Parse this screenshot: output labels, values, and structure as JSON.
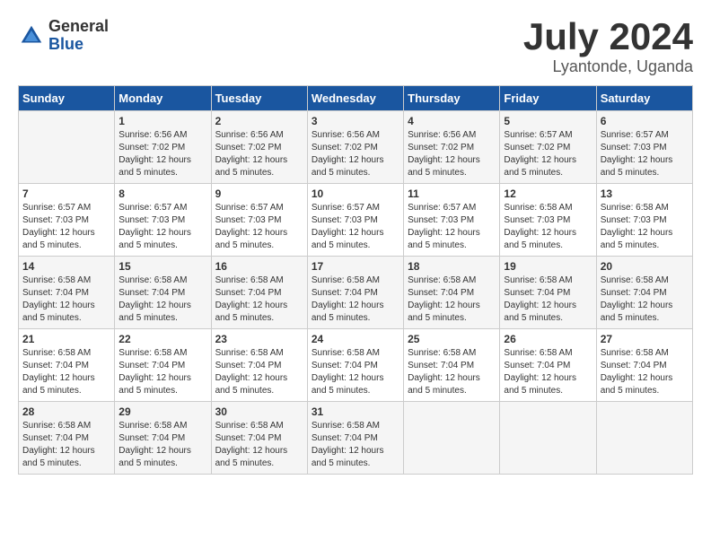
{
  "logo": {
    "general": "General",
    "blue": "Blue"
  },
  "title": {
    "month": "July 2024",
    "location": "Lyantonde, Uganda"
  },
  "calendar": {
    "headers": [
      "Sunday",
      "Monday",
      "Tuesday",
      "Wednesday",
      "Thursday",
      "Friday",
      "Saturday"
    ],
    "weeks": [
      [
        {
          "num": "",
          "info": ""
        },
        {
          "num": "1",
          "info": "Sunrise: 6:56 AM\nSunset: 7:02 PM\nDaylight: 12 hours\nand 5 minutes."
        },
        {
          "num": "2",
          "info": "Sunrise: 6:56 AM\nSunset: 7:02 PM\nDaylight: 12 hours\nand 5 minutes."
        },
        {
          "num": "3",
          "info": "Sunrise: 6:56 AM\nSunset: 7:02 PM\nDaylight: 12 hours\nand 5 minutes."
        },
        {
          "num": "4",
          "info": "Sunrise: 6:56 AM\nSunset: 7:02 PM\nDaylight: 12 hours\nand 5 minutes."
        },
        {
          "num": "5",
          "info": "Sunrise: 6:57 AM\nSunset: 7:02 PM\nDaylight: 12 hours\nand 5 minutes."
        },
        {
          "num": "6",
          "info": "Sunrise: 6:57 AM\nSunset: 7:03 PM\nDaylight: 12 hours\nand 5 minutes."
        }
      ],
      [
        {
          "num": "7",
          "info": "Sunrise: 6:57 AM\nSunset: 7:03 PM\nDaylight: 12 hours\nand 5 minutes."
        },
        {
          "num": "8",
          "info": "Sunrise: 6:57 AM\nSunset: 7:03 PM\nDaylight: 12 hours\nand 5 minutes."
        },
        {
          "num": "9",
          "info": "Sunrise: 6:57 AM\nSunset: 7:03 PM\nDaylight: 12 hours\nand 5 minutes."
        },
        {
          "num": "10",
          "info": "Sunrise: 6:57 AM\nSunset: 7:03 PM\nDaylight: 12 hours\nand 5 minutes."
        },
        {
          "num": "11",
          "info": "Sunrise: 6:57 AM\nSunset: 7:03 PM\nDaylight: 12 hours\nand 5 minutes."
        },
        {
          "num": "12",
          "info": "Sunrise: 6:58 AM\nSunset: 7:03 PM\nDaylight: 12 hours\nand 5 minutes."
        },
        {
          "num": "13",
          "info": "Sunrise: 6:58 AM\nSunset: 7:03 PM\nDaylight: 12 hours\nand 5 minutes."
        }
      ],
      [
        {
          "num": "14",
          "info": "Sunrise: 6:58 AM\nSunset: 7:04 PM\nDaylight: 12 hours\nand 5 minutes."
        },
        {
          "num": "15",
          "info": "Sunrise: 6:58 AM\nSunset: 7:04 PM\nDaylight: 12 hours\nand 5 minutes."
        },
        {
          "num": "16",
          "info": "Sunrise: 6:58 AM\nSunset: 7:04 PM\nDaylight: 12 hours\nand 5 minutes."
        },
        {
          "num": "17",
          "info": "Sunrise: 6:58 AM\nSunset: 7:04 PM\nDaylight: 12 hours\nand 5 minutes."
        },
        {
          "num": "18",
          "info": "Sunrise: 6:58 AM\nSunset: 7:04 PM\nDaylight: 12 hours\nand 5 minutes."
        },
        {
          "num": "19",
          "info": "Sunrise: 6:58 AM\nSunset: 7:04 PM\nDaylight: 12 hours\nand 5 minutes."
        },
        {
          "num": "20",
          "info": "Sunrise: 6:58 AM\nSunset: 7:04 PM\nDaylight: 12 hours\nand 5 minutes."
        }
      ],
      [
        {
          "num": "21",
          "info": "Sunrise: 6:58 AM\nSunset: 7:04 PM\nDaylight: 12 hours\nand 5 minutes."
        },
        {
          "num": "22",
          "info": "Sunrise: 6:58 AM\nSunset: 7:04 PM\nDaylight: 12 hours\nand 5 minutes."
        },
        {
          "num": "23",
          "info": "Sunrise: 6:58 AM\nSunset: 7:04 PM\nDaylight: 12 hours\nand 5 minutes."
        },
        {
          "num": "24",
          "info": "Sunrise: 6:58 AM\nSunset: 7:04 PM\nDaylight: 12 hours\nand 5 minutes."
        },
        {
          "num": "25",
          "info": "Sunrise: 6:58 AM\nSunset: 7:04 PM\nDaylight: 12 hours\nand 5 minutes."
        },
        {
          "num": "26",
          "info": "Sunrise: 6:58 AM\nSunset: 7:04 PM\nDaylight: 12 hours\nand 5 minutes."
        },
        {
          "num": "27",
          "info": "Sunrise: 6:58 AM\nSunset: 7:04 PM\nDaylight: 12 hours\nand 5 minutes."
        }
      ],
      [
        {
          "num": "28",
          "info": "Sunrise: 6:58 AM\nSunset: 7:04 PM\nDaylight: 12 hours\nand 5 minutes."
        },
        {
          "num": "29",
          "info": "Sunrise: 6:58 AM\nSunset: 7:04 PM\nDaylight: 12 hours\nand 5 minutes."
        },
        {
          "num": "30",
          "info": "Sunrise: 6:58 AM\nSunset: 7:04 PM\nDaylight: 12 hours\nand 5 minutes."
        },
        {
          "num": "31",
          "info": "Sunrise: 6:58 AM\nSunset: 7:04 PM\nDaylight: 12 hours\nand 5 minutes."
        },
        {
          "num": "",
          "info": ""
        },
        {
          "num": "",
          "info": ""
        },
        {
          "num": "",
          "info": ""
        }
      ]
    ]
  }
}
